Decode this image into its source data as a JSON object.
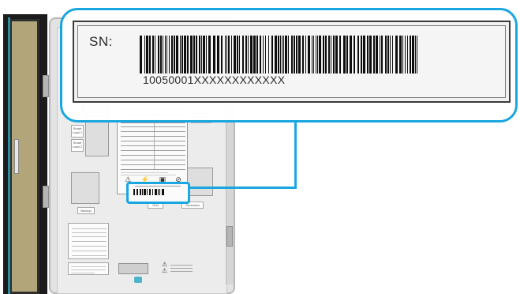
{
  "serial_label": {
    "prefix": "SN:",
    "number": "10050001XXXXXXXXXXXX",
    "highlight_color": "#1aa6e0"
  },
  "panel_labels": {
    "smart_load_1": "Smart Load 1",
    "smart_load_2": "Smart Load 2",
    "backup": "Backup",
    "grid": "Grid",
    "generator": "Generator"
  },
  "icons": [
    "warning-triangle-icon",
    "electric-hazard-icon",
    "manual-icon",
    "no-disposal-icon"
  ]
}
